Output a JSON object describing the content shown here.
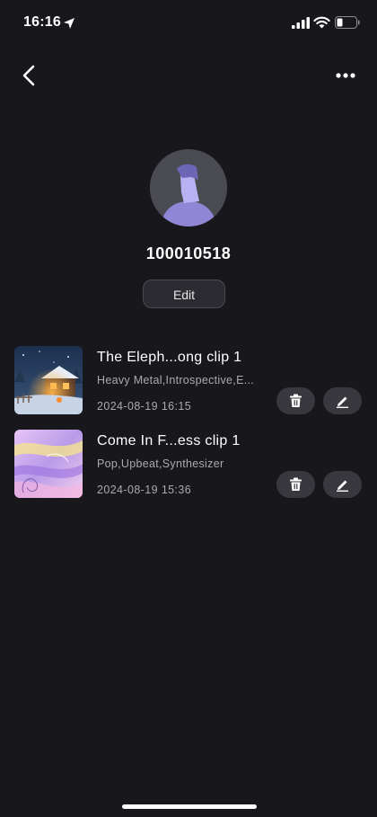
{
  "status_bar": {
    "time": "16:16"
  },
  "nav": {
    "back_icon": "chevron-left-icon",
    "more_icon": "ellipsis-icon"
  },
  "profile": {
    "username": "100010518",
    "edit_label": "Edit"
  },
  "items": [
    {
      "title": "The Eleph...ong clip 1",
      "tags": "Heavy Metal,Introspective,E...",
      "date": "2024-08-19 16:15"
    },
    {
      "title": "Come In F...ess clip 1",
      "tags": "Pop,Upbeat,Synthesizer",
      "date": "2024-08-19 15:36"
    }
  ],
  "colors": {
    "background": "#18181c",
    "button_bg": "#38383e",
    "secondary_text": "#a9a9b0",
    "avatar_accent": "#8f86d6"
  }
}
